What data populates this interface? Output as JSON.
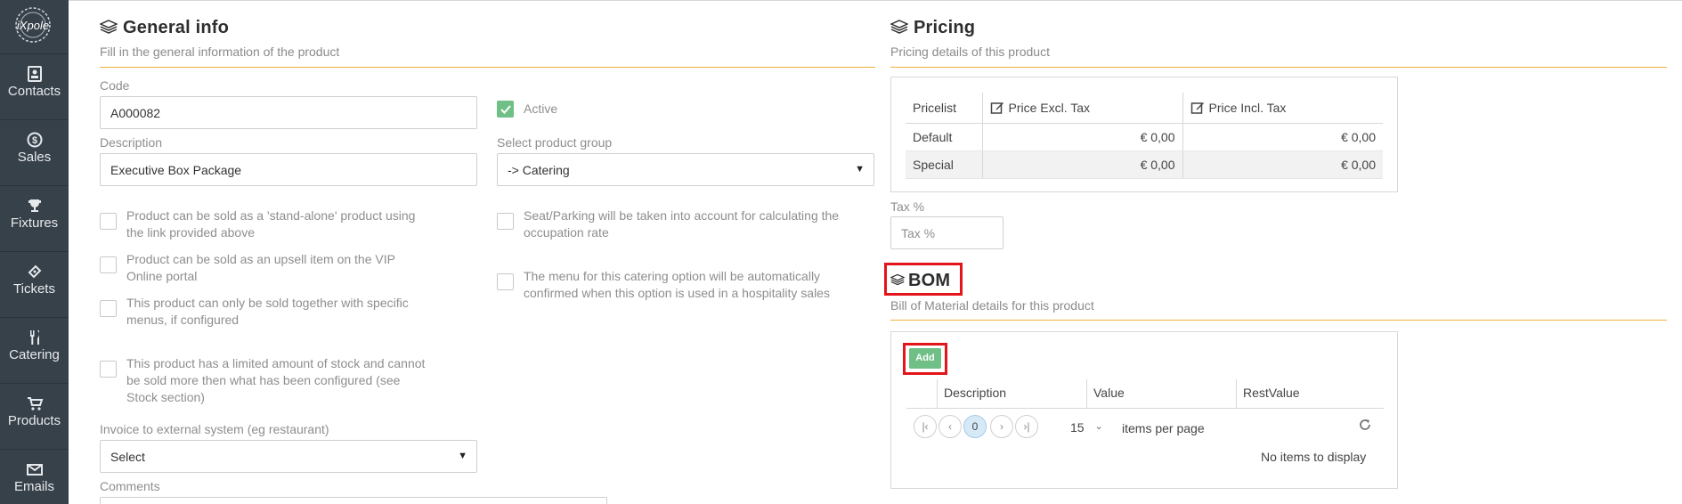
{
  "sidebar": {
    "logo_text": "iXpole",
    "items": [
      {
        "label": "Contacts",
        "icon": "contacts-icon"
      },
      {
        "label": "Sales",
        "icon": "sales-icon"
      },
      {
        "label": "Fixtures",
        "icon": "trophy-icon"
      },
      {
        "label": "Tickets",
        "icon": "ticket-icon"
      },
      {
        "label": "Catering",
        "icon": "cutlery-icon"
      },
      {
        "label": "Products",
        "icon": "cart-icon"
      },
      {
        "label": "Emails",
        "icon": "envelope-icon"
      }
    ]
  },
  "general": {
    "title": "General info",
    "subtitle": "Fill in the general information of the product",
    "code_label": "Code",
    "code_value": "A000082",
    "active_label": "Active",
    "description_label": "Description",
    "description_value": "Executive Box Package",
    "product_group_label": "Select product group",
    "product_group_value": "-> Catering",
    "options_left": [
      "Product can be sold as a 'stand-alone' product using the link provided above",
      "Product can be sold as an upsell item on the VIP Online portal",
      "This product can only be sold together with specific menus, if configured",
      "This product has a limited amount of stock and cannot be sold more then what has been configured (see Stock section)"
    ],
    "options_right": [
      "Seat/Parking will be taken into account for calculating the occupation rate",
      "The menu for this catering option will be automatically confirmed when this option is used in a hospitality sales"
    ],
    "invoice_label": "Invoice to external system (eg restaurant)",
    "invoice_value": "Select",
    "comments_label": "Comments"
  },
  "pricing": {
    "title": "Pricing",
    "subtitle": "Pricing details of this product",
    "columns": [
      "Pricelist",
      "Price Excl. Tax",
      "Price Incl. Tax"
    ],
    "rows": [
      {
        "pricelist": "Default",
        "excl": "€ 0,00",
        "incl": "€ 0,00"
      },
      {
        "pricelist": "Special",
        "excl": "€ 0,00",
        "incl": "€ 0,00"
      }
    ],
    "tax_label": "Tax %",
    "tax_placeholder": "Tax %"
  },
  "bom": {
    "title": "BOM",
    "subtitle": "Bill of Material details for this product",
    "add_label": "Add",
    "columns": [
      "Description",
      "Value",
      "RestValue"
    ],
    "pager": {
      "current_page": "0",
      "page_size": "15",
      "items_per_page_label": "items per page"
    },
    "empty_text": "No items to display"
  },
  "colors": {
    "sidebar": "#37414a",
    "accent_rule": "#f0b33b",
    "success": "#6fbf86",
    "highlight": "#e3151a"
  }
}
